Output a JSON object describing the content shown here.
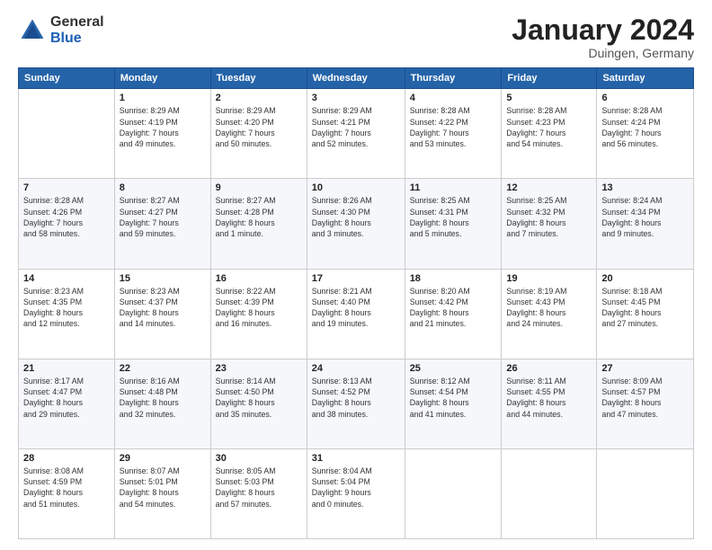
{
  "header": {
    "logo_general": "General",
    "logo_blue": "Blue",
    "month_year": "January 2024",
    "location": "Duingen, Germany"
  },
  "weekdays": [
    "Sunday",
    "Monday",
    "Tuesday",
    "Wednesday",
    "Thursday",
    "Friday",
    "Saturday"
  ],
  "weeks": [
    [
      {
        "day": "",
        "info": ""
      },
      {
        "day": "1",
        "info": "Sunrise: 8:29 AM\nSunset: 4:19 PM\nDaylight: 7 hours\nand 49 minutes."
      },
      {
        "day": "2",
        "info": "Sunrise: 8:29 AM\nSunset: 4:20 PM\nDaylight: 7 hours\nand 50 minutes."
      },
      {
        "day": "3",
        "info": "Sunrise: 8:29 AM\nSunset: 4:21 PM\nDaylight: 7 hours\nand 52 minutes."
      },
      {
        "day": "4",
        "info": "Sunrise: 8:28 AM\nSunset: 4:22 PM\nDaylight: 7 hours\nand 53 minutes."
      },
      {
        "day": "5",
        "info": "Sunrise: 8:28 AM\nSunset: 4:23 PM\nDaylight: 7 hours\nand 54 minutes."
      },
      {
        "day": "6",
        "info": "Sunrise: 8:28 AM\nSunset: 4:24 PM\nDaylight: 7 hours\nand 56 minutes."
      }
    ],
    [
      {
        "day": "7",
        "info": "Sunrise: 8:28 AM\nSunset: 4:26 PM\nDaylight: 7 hours\nand 58 minutes."
      },
      {
        "day": "8",
        "info": "Sunrise: 8:27 AM\nSunset: 4:27 PM\nDaylight: 7 hours\nand 59 minutes."
      },
      {
        "day": "9",
        "info": "Sunrise: 8:27 AM\nSunset: 4:28 PM\nDaylight: 8 hours\nand 1 minute."
      },
      {
        "day": "10",
        "info": "Sunrise: 8:26 AM\nSunset: 4:30 PM\nDaylight: 8 hours\nand 3 minutes."
      },
      {
        "day": "11",
        "info": "Sunrise: 8:25 AM\nSunset: 4:31 PM\nDaylight: 8 hours\nand 5 minutes."
      },
      {
        "day": "12",
        "info": "Sunrise: 8:25 AM\nSunset: 4:32 PM\nDaylight: 8 hours\nand 7 minutes."
      },
      {
        "day": "13",
        "info": "Sunrise: 8:24 AM\nSunset: 4:34 PM\nDaylight: 8 hours\nand 9 minutes."
      }
    ],
    [
      {
        "day": "14",
        "info": "Sunrise: 8:23 AM\nSunset: 4:35 PM\nDaylight: 8 hours\nand 12 minutes."
      },
      {
        "day": "15",
        "info": "Sunrise: 8:23 AM\nSunset: 4:37 PM\nDaylight: 8 hours\nand 14 minutes."
      },
      {
        "day": "16",
        "info": "Sunrise: 8:22 AM\nSunset: 4:39 PM\nDaylight: 8 hours\nand 16 minutes."
      },
      {
        "day": "17",
        "info": "Sunrise: 8:21 AM\nSunset: 4:40 PM\nDaylight: 8 hours\nand 19 minutes."
      },
      {
        "day": "18",
        "info": "Sunrise: 8:20 AM\nSunset: 4:42 PM\nDaylight: 8 hours\nand 21 minutes."
      },
      {
        "day": "19",
        "info": "Sunrise: 8:19 AM\nSunset: 4:43 PM\nDaylight: 8 hours\nand 24 minutes."
      },
      {
        "day": "20",
        "info": "Sunrise: 8:18 AM\nSunset: 4:45 PM\nDaylight: 8 hours\nand 27 minutes."
      }
    ],
    [
      {
        "day": "21",
        "info": "Sunrise: 8:17 AM\nSunset: 4:47 PM\nDaylight: 8 hours\nand 29 minutes."
      },
      {
        "day": "22",
        "info": "Sunrise: 8:16 AM\nSunset: 4:48 PM\nDaylight: 8 hours\nand 32 minutes."
      },
      {
        "day": "23",
        "info": "Sunrise: 8:14 AM\nSunset: 4:50 PM\nDaylight: 8 hours\nand 35 minutes."
      },
      {
        "day": "24",
        "info": "Sunrise: 8:13 AM\nSunset: 4:52 PM\nDaylight: 8 hours\nand 38 minutes."
      },
      {
        "day": "25",
        "info": "Sunrise: 8:12 AM\nSunset: 4:54 PM\nDaylight: 8 hours\nand 41 minutes."
      },
      {
        "day": "26",
        "info": "Sunrise: 8:11 AM\nSunset: 4:55 PM\nDaylight: 8 hours\nand 44 minutes."
      },
      {
        "day": "27",
        "info": "Sunrise: 8:09 AM\nSunset: 4:57 PM\nDaylight: 8 hours\nand 47 minutes."
      }
    ],
    [
      {
        "day": "28",
        "info": "Sunrise: 8:08 AM\nSunset: 4:59 PM\nDaylight: 8 hours\nand 51 minutes."
      },
      {
        "day": "29",
        "info": "Sunrise: 8:07 AM\nSunset: 5:01 PM\nDaylight: 8 hours\nand 54 minutes."
      },
      {
        "day": "30",
        "info": "Sunrise: 8:05 AM\nSunset: 5:03 PM\nDaylight: 8 hours\nand 57 minutes."
      },
      {
        "day": "31",
        "info": "Sunrise: 8:04 AM\nSunset: 5:04 PM\nDaylight: 9 hours\nand 0 minutes."
      },
      {
        "day": "",
        "info": ""
      },
      {
        "day": "",
        "info": ""
      },
      {
        "day": "",
        "info": ""
      }
    ]
  ]
}
